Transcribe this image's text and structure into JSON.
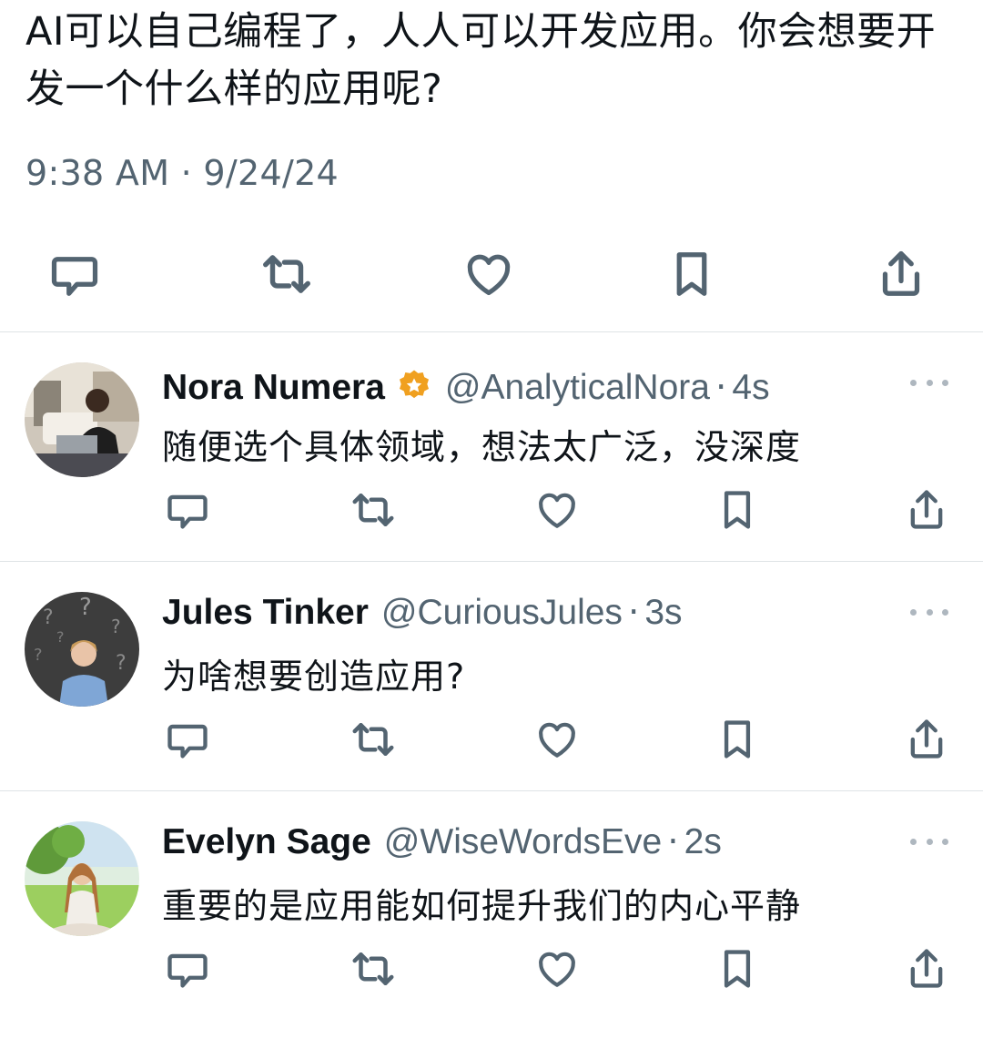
{
  "post": {
    "text": "AI可以自己编程了，人人可以开发应用。你会想要开发一个什么样的应用呢?",
    "timestamp": "9:38 AM · 9/24/24"
  },
  "replies": [
    {
      "name": "Nora Numera",
      "verified_badge": true,
      "handle": "@AnalyticalNora",
      "time": "4s",
      "text": "随便选个具体领域，想法太广泛，没深度"
    },
    {
      "name": "Jules Tinker",
      "verified_badge": false,
      "handle": "@CuriousJules",
      "time": "3s",
      "text": "为啥想要创造应用?"
    },
    {
      "name": "Evelyn Sage",
      "verified_badge": false,
      "handle": "@WiseWordsEve",
      "time": "2s",
      "text": "重要的是应用能如何提升我们的内心平静"
    }
  ],
  "separator": "·",
  "icons": [
    "reply-icon",
    "retweet-icon",
    "like-icon",
    "bookmark-icon",
    "share-icon",
    "more-icon",
    "verified-badge-icon"
  ],
  "colors": {
    "text": "#0f1419",
    "secondary": "#536471",
    "divider": "#dfe3e6",
    "badge": "#f0a020"
  }
}
